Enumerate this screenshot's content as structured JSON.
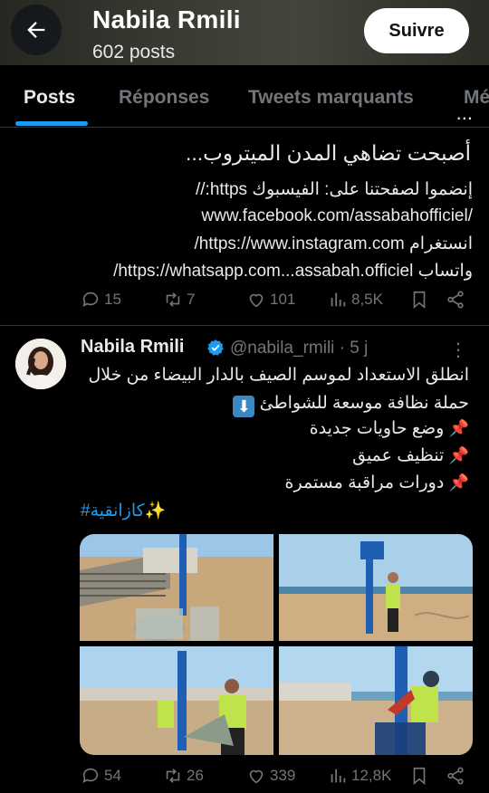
{
  "header": {
    "name": "Nabila Rmili",
    "posts_count": "602 posts",
    "follow_label": "Suivre"
  },
  "tabs": [
    {
      "label": "Posts",
      "active": true
    },
    {
      "label": "Réponses",
      "active": false
    },
    {
      "label": "Tweets marquants",
      "active": false
    },
    {
      "label": "Médias",
      "active": false
    }
  ],
  "tweet1": {
    "lines": [
      "أصبحت تضاهي المدن الميتروب...",
      "إنضموا لصفحتنا على: الفيسبوك https://",
      "www.facebook.com/assabahofficiel/",
      "انستغرام https://www.instagram.com/",
      "واتساب https://whatsapp.com...assabah.officiel/"
    ],
    "stats": {
      "replies": "15",
      "retweets": "7",
      "likes": "101",
      "views": "8,5K"
    }
  },
  "tweet2": {
    "author": "Nabila Rmili",
    "handle": "@nabila_rmili · 5 j",
    "lines": [
      "انطلق الاستعداد لموسم الصيف بالدار البيضاء من خلال",
      "حملة نظافة موسعة للشواطئ",
      "وضع حاويات جديدة",
      "تنظيف عميق",
      "دورات مراقبة مستمرة"
    ],
    "hashtag": "#كازانقية",
    "stats": {
      "replies": "54",
      "retweets": "26",
      "likes": "339",
      "views": "12,8K"
    }
  },
  "colors": {
    "accent": "#1d9bf0",
    "muted": "#71767b",
    "background": "#000000",
    "text": "#e7e9ea"
  }
}
